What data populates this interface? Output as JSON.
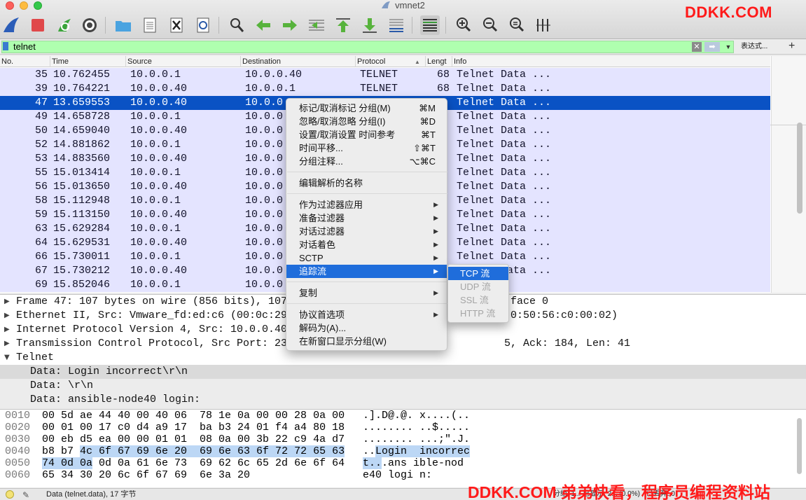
{
  "window": {
    "title": "vmnet2"
  },
  "watermarks": {
    "top": "DDKK.COM",
    "bottom": "DDKK.COM 弟弟快看，程序员编程资料站"
  },
  "toolbar": {
    "icons": [
      "shark-fin-icon",
      "stop-icon",
      "restart-icon",
      "gear-icon",
      "folder-open-icon",
      "file-save-icon",
      "file-close-icon",
      "reload-icon",
      "search-icon",
      "arrow-back-icon",
      "arrow-forward-icon",
      "goto-packet-icon",
      "goto-first-icon",
      "goto-last-icon",
      "autoscroll-icon",
      "colorize-icon",
      "zoom-in-icon",
      "zoom-out-icon",
      "zoom-reset-icon",
      "resize-columns-icon"
    ]
  },
  "filter": {
    "value": "telnet",
    "expression_label": "表达式...",
    "add_label": "+"
  },
  "packet_list": {
    "columns": [
      "No.",
      "Time",
      "Source",
      "Destination",
      "Protocol",
      "Lengt",
      "Info"
    ],
    "rows": [
      {
        "no": "35",
        "time": "10.762455",
        "src": "10.0.0.1",
        "dst": "10.0.0.40",
        "proto": "TELNET",
        "len": "68",
        "info": "Telnet Data ..."
      },
      {
        "no": "39",
        "time": "10.764221",
        "src": "10.0.0.40",
        "dst": "10.0.0.1",
        "proto": "TELNET",
        "len": "68",
        "info": "Telnet Data ..."
      },
      {
        "no": "47",
        "time": "13.659553",
        "src": "10.0.0.40",
        "dst": "10.0.0",
        "proto": "",
        "len": "",
        "info": "Telnet Data ..."
      },
      {
        "no": "49",
        "time": "14.658728",
        "src": "10.0.0.1",
        "dst": "10.0.0",
        "proto": "",
        "len": "",
        "info": "Telnet Data ..."
      },
      {
        "no": "50",
        "time": "14.659040",
        "src": "10.0.0.40",
        "dst": "10.0.0",
        "proto": "",
        "len": "",
        "info": "Telnet Data ..."
      },
      {
        "no": "52",
        "time": "14.881862",
        "src": "10.0.0.1",
        "dst": "10.0.0",
        "proto": "",
        "len": "",
        "info": "Telnet Data ..."
      },
      {
        "no": "53",
        "time": "14.883560",
        "src": "10.0.0.40",
        "dst": "10.0.0",
        "proto": "",
        "len": "",
        "info": "Telnet Data ..."
      },
      {
        "no": "55",
        "time": "15.013414",
        "src": "10.0.0.1",
        "dst": "10.0.0",
        "proto": "",
        "len": "",
        "info": "Telnet Data ..."
      },
      {
        "no": "56",
        "time": "15.013650",
        "src": "10.0.0.40",
        "dst": "10.0.0",
        "proto": "",
        "len": "",
        "info": "Telnet Data ..."
      },
      {
        "no": "58",
        "time": "15.112948",
        "src": "10.0.0.1",
        "dst": "10.0.0",
        "proto": "",
        "len": "",
        "info": "Telnet Data ..."
      },
      {
        "no": "59",
        "time": "15.113150",
        "src": "10.0.0.40",
        "dst": "10.0.0",
        "proto": "",
        "len": "",
        "info": "Telnet Data ..."
      },
      {
        "no": "63",
        "time": "15.629284",
        "src": "10.0.0.1",
        "dst": "10.0.0",
        "proto": "",
        "len": "",
        "info": "Telnet Data ..."
      },
      {
        "no": "64",
        "time": "15.629531",
        "src": "10.0.0.40",
        "dst": "10.0.0",
        "proto": "",
        "len": "",
        "info": "Telnet Data ..."
      },
      {
        "no": "66",
        "time": "15.730011",
        "src": "10.0.0.1",
        "dst": "10.0.0",
        "proto": "",
        "len": "",
        "info": "Telnet Data ..."
      },
      {
        "no": "67",
        "time": "15.730212",
        "src": "10.0.0.40",
        "dst": "10.0.0",
        "proto": "",
        "len": "",
        "info": "Telnet Data ..."
      },
      {
        "no": "69",
        "time": "15.852046",
        "src": "10.0.0.1",
        "dst": "10.0.0",
        "proto": "",
        "len": "",
        "info": "ata ..."
      }
    ]
  },
  "details": {
    "rows": [
      {
        "text": "Frame 47: 107 bytes on wire (856 bits), 107",
        "tail": "face 0",
        "tail_col": 81
      },
      {
        "text": "Ethernet II, Src: Vmware_fd:ed:c6 (00:0c:29",
        "tail": "0:50:56:c0:00:02)",
        "tail_col": 81
      },
      {
        "text": "Internet Protocol Version 4, Src: 10.0.0.40",
        "tail": "",
        "tail_col": 0
      },
      {
        "text": "Transmission Control Protocol, Src Port: 23",
        "tail": "5, Ack: 184, Len: 41",
        "tail_col": 80
      },
      {
        "text": "Telnet",
        "tail": "",
        "tail_col": 0
      }
    ],
    "sub_rows": [
      "Data: Login incorrect\\r\\n",
      "Data: \\r\\n",
      "Data: ansible-node40 login:"
    ]
  },
  "bytes": {
    "rows": [
      {
        "off": "0010",
        "hex": "00 5d ae 44 40 00 40 06  78 1e 0a 00 00 28 0a 00",
        "asc": ".].D@.@. x....(.."
      },
      {
        "off": "0020",
        "hex": "00 01 00 17 c0 d4 a9 17  ba b3 24 01 f4 a4 80 18",
        "asc": "........ ..$....."
      },
      {
        "off": "0030",
        "hex": "00 eb d5 ea 00 00 01 01  08 0a 00 3b 22 c9 4a d7",
        "asc": "........ ...;\".J."
      },
      {
        "off": "0040",
        "hex_pre": "b8 b7 ",
        "hex_hi": "4c 6f 67 69 6e 20  69 6e 63 6f 72 72 65 63",
        "asc_pre": "..",
        "asc_hi": "Login  incorrec"
      },
      {
        "off": "0050",
        "hex_hi": "74 0d 0a",
        "hex_post": " 0d 0a 61 6e 73  69 62 6c 65 2d 6e 6f 64",
        "asc_hi": "t..",
        "asc_post": ".ans ible-nod"
      },
      {
        "off": "0060",
        "hex": "65 34 30 20 6c 6f 67 69  6e 3a 20",
        "asc": "e40 logi n:"
      }
    ]
  },
  "status": {
    "text": "Data (telnet.data), 17 字节",
    "right": "分组: 1... 已显示: 2... (0.0%) · 已丢弃: 0"
  },
  "context_menu": {
    "items": [
      {
        "label": "标记/取消标记 分组(M)",
        "shortcut": "⌘M"
      },
      {
        "label": "忽略/取消忽略 分组(I)",
        "shortcut": "⌘D"
      },
      {
        "label": "设置/取消设置 时间参考",
        "shortcut": "⌘T"
      },
      {
        "label": "时间平移...",
        "shortcut": "⇧⌘T"
      },
      {
        "label": "分组注释...",
        "shortcut": "⌥⌘C"
      },
      {
        "label": "编辑解析的名称",
        "shortcut": ""
      },
      {
        "label": "作为过滤器应用",
        "shortcut": "▶"
      },
      {
        "label": "准备过滤器",
        "shortcut": "▶"
      },
      {
        "label": "对话过滤器",
        "shortcut": "▶"
      },
      {
        "label": "对话着色",
        "shortcut": "▶"
      },
      {
        "label": "SCTP",
        "shortcut": "▶"
      },
      {
        "label": "追踪流",
        "shortcut": "▶"
      },
      {
        "label": "复制",
        "shortcut": "▶"
      },
      {
        "label": "协议首选项",
        "shortcut": "▶"
      },
      {
        "label": "解码为(A)...",
        "shortcut": ""
      },
      {
        "label": "在新窗口显示分组(W)",
        "shortcut": ""
      }
    ]
  },
  "submenu": {
    "items": [
      "TCP 流",
      "UDP 流",
      "SSL 流",
      "HTTP 流"
    ]
  }
}
